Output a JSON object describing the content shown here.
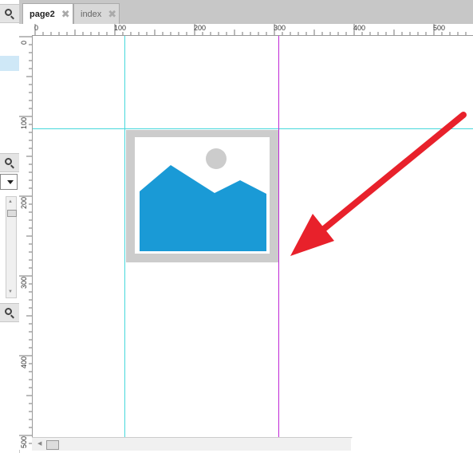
{
  "tabs": [
    {
      "label": "page2",
      "active": true
    },
    {
      "label": "index",
      "active": false
    }
  ],
  "ruler": {
    "h_labels": [
      "0",
      "100",
      "200",
      "300",
      "400",
      "500"
    ],
    "v_labels": [
      "0",
      "100",
      "200",
      "300",
      "400",
      "500"
    ]
  },
  "colors": {
    "guide_cyan": "#46d8dc",
    "guide_magenta": "#c028d6",
    "image_blue": "#1a9ad6",
    "image_frame": "#cccccc",
    "arrow": "#e8212b"
  },
  "canvas": {
    "widget": "image-placeholder-icon"
  }
}
